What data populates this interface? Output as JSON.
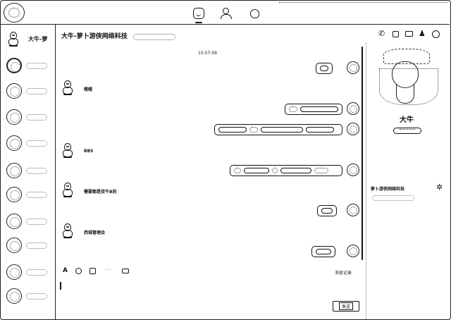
{
  "sidebar": {
    "user_name": "大牛-萝",
    "contacts": [
      {
        "id": "c1"
      },
      {
        "id": "c2"
      },
      {
        "id": "c3"
      },
      {
        "id": "c4"
      },
      {
        "id": "c5"
      },
      {
        "id": "c6"
      },
      {
        "id": "c7"
      },
      {
        "id": "c8"
      },
      {
        "id": "c9"
      },
      {
        "id": "c10"
      },
      {
        "id": "c11"
      },
      {
        "id": "c12"
      }
    ]
  },
  "chat": {
    "title": "大牛-萝卜游侠网络科技",
    "timestamp": "15:57:09",
    "incoming": [
      {
        "text": "嗯嗯"
      },
      {
        "text": "BBS"
      },
      {
        "text": "需要都是双牛B的"
      },
      {
        "text": "西城管理会"
      }
    ]
  },
  "composer": {
    "history_label": "消息记录",
    "send_label": "发送"
  },
  "profile": {
    "name": "大牛",
    "group_label": "萝卜游侠网络科技"
  },
  "icons": {
    "nav": [
      "chat-icon",
      "contacts-icon",
      "spaces-icon"
    ],
    "toolbar": [
      "phone-icon",
      "video-icon",
      "screen-share-icon",
      "add-user-icon",
      "more-icon"
    ],
    "composer": [
      "font-icon",
      "emoji-icon",
      "image-icon",
      "file-icon",
      "folder-icon"
    ]
  }
}
